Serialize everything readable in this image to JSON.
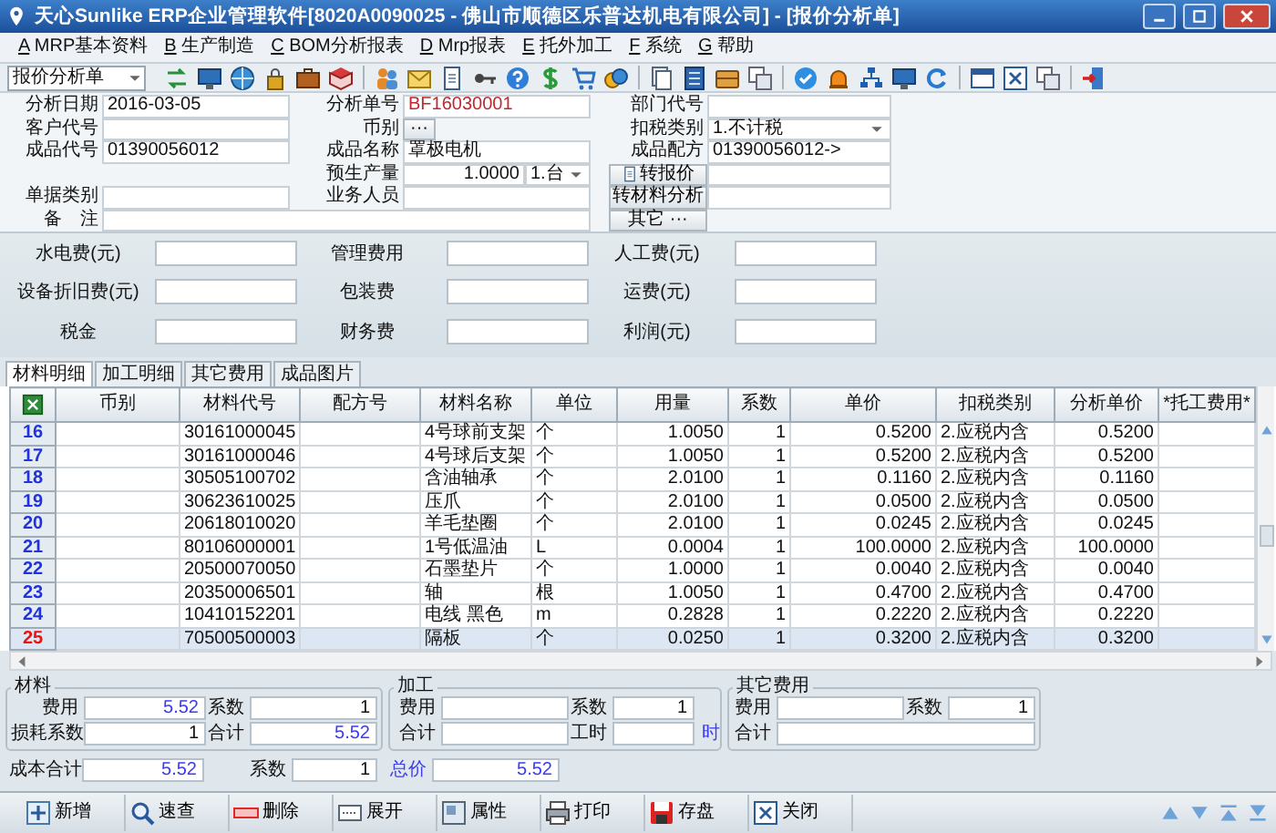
{
  "window": {
    "title": "天心Sunlike ERP企业管理软件[8020A0090025 - 佛山市顺德区乐普达机电有限公司] - [报价分析单]"
  },
  "menu": [
    {
      "key": "A",
      "label": "MRP基本资料"
    },
    {
      "key": "B",
      "label": "生产制造"
    },
    {
      "key": "C",
      "label": "BOM分析报表"
    },
    {
      "key": "D",
      "label": "Mrp报表"
    },
    {
      "key": "E",
      "label": "托外加工"
    },
    {
      "key": "F",
      "label": "系统"
    },
    {
      "key": "G",
      "label": "帮助"
    }
  ],
  "toolbar": {
    "document_type": "报价分析单"
  },
  "header": [
    {
      "left": {
        "kind": "text",
        "label": "分析日期",
        "value": "2016-03-05"
      },
      "middle": {
        "kind": "code",
        "label": "分析单号",
        "value": "BF16030001"
      },
      "right": {
        "kind": "text",
        "label": "部门代号"
      }
    },
    {
      "left": {
        "kind": "text",
        "label": "客户代号"
      },
      "middle": {
        "kind": "picker",
        "label": "币别",
        "button": "···"
      },
      "right": {
        "kind": "select",
        "label": "扣税类别",
        "value": "1.不计税"
      }
    },
    {
      "left": {
        "kind": "text",
        "label": "成品代号",
        "value": "01390056012"
      },
      "middle": {
        "kind": "text",
        "label": "成品名称",
        "value": "罩极电机"
      },
      "right": {
        "kind": "text",
        "label": "成品配方",
        "value": "01390056012->"
      }
    },
    {
      "middle": {
        "kind": "quantity",
        "label": "预生产量",
        "value": "1.0000",
        "unit": "1.台"
      },
      "right": {
        "kind": "action",
        "button": "转报价"
      }
    },
    {
      "left": {
        "kind": "text",
        "label": "单据类别"
      },
      "middle": {
        "kind": "text",
        "label": "业务人员"
      },
      "right": {
        "kind": "action",
        "button": "转材料分析"
      }
    },
    {
      "left": {
        "kind": "memo",
        "label": "备　注"
      },
      "right": {
        "kind": "action",
        "button": "其它 ···"
      }
    }
  ],
  "costs": [
    {
      "label": "水电费(元)"
    },
    {
      "label": "管理费用"
    },
    {
      "label": "人工费(元)"
    },
    {
      "label": "设备折旧费(元)"
    },
    {
      "label": "包装费"
    },
    {
      "label": "运费(元)"
    },
    {
      "label": "税金"
    },
    {
      "label": "财务费"
    },
    {
      "label": "利润(元)"
    }
  ],
  "tabs": [
    {
      "label": "材料明细",
      "selected": true
    },
    {
      "label": "加工明细",
      "selected": false
    },
    {
      "label": "其它费用",
      "selected": false
    },
    {
      "label": "成品图片",
      "selected": false
    }
  ],
  "table": {
    "columns": [
      {
        "label": "币别"
      },
      {
        "label": "材料代号"
      },
      {
        "label": "配方号"
      },
      {
        "label": "材料名称"
      },
      {
        "label": "单位"
      },
      {
        "label": "用量"
      },
      {
        "label": "系数"
      },
      {
        "label": "单价"
      },
      {
        "label": "扣税类别"
      },
      {
        "label": "分析单价"
      },
      {
        "label": "*托工费用*"
      }
    ],
    "rows": [
      {
        "no": "16",
        "code": "30161000045",
        "name": "4号球前支架",
        "unit": "个",
        "qty": "1.0050",
        "factor": "1",
        "price": "0.5200",
        "tax": "2.应税内含",
        "aprice": "0.5200",
        "selected": false
      },
      {
        "no": "17",
        "code": "30161000046",
        "name": "4号球后支架",
        "unit": "个",
        "qty": "1.0050",
        "factor": "1",
        "price": "0.5200",
        "tax": "2.应税内含",
        "aprice": "0.5200",
        "selected": false
      },
      {
        "no": "18",
        "code": "30505100702",
        "name": "含油轴承",
        "unit": "个",
        "qty": "2.0100",
        "factor": "1",
        "price": "0.1160",
        "tax": "2.应税内含",
        "aprice": "0.1160",
        "selected": false
      },
      {
        "no": "19",
        "code": "30623610025",
        "name": "压爪",
        "unit": "个",
        "qty": "2.0100",
        "factor": "1",
        "price": "0.0500",
        "tax": "2.应税内含",
        "aprice": "0.0500",
        "selected": false
      },
      {
        "no": "20",
        "code": "20618010020",
        "name": "羊毛垫圈",
        "unit": "个",
        "qty": "2.0100",
        "factor": "1",
        "price": "0.0245",
        "tax": "2.应税内含",
        "aprice": "0.0245",
        "selected": false
      },
      {
        "no": "21",
        "code": "80106000001",
        "name": "1号低温油",
        "unit": "L",
        "qty": "0.0004",
        "factor": "1",
        "price": "100.0000",
        "tax": "2.应税内含",
        "aprice": "100.0000",
        "selected": false
      },
      {
        "no": "22",
        "code": "20500070050",
        "name": "石墨垫片",
        "unit": "个",
        "qty": "1.0000",
        "factor": "1",
        "price": "0.0040",
        "tax": "2.应税内含",
        "aprice": "0.0040",
        "selected": false
      },
      {
        "no": "23",
        "code": "20350006501",
        "name": "轴",
        "unit": "根",
        "qty": "1.0050",
        "factor": "1",
        "price": "0.4700",
        "tax": "2.应税内含",
        "aprice": "0.4700",
        "selected": false
      },
      {
        "no": "24",
        "code": "10410152201",
        "name": "电线 黑色",
        "unit": "m",
        "qty": "0.2828",
        "factor": "1",
        "price": "0.2220",
        "tax": "2.应税内含",
        "aprice": "0.2220",
        "selected": false
      },
      {
        "no": "25",
        "code": "70500500003",
        "name": "隔板",
        "unit": "个",
        "qty": "0.0250",
        "factor": "1",
        "price": "0.3200",
        "tax": "2.应税内含",
        "aprice": "0.3200",
        "selected": true
      }
    ]
  },
  "summary": {
    "groups": [
      {
        "title": "材料",
        "fields": [
          {
            "label": "费用",
            "value": "5.52",
            "highlight": true
          },
          {
            "label": "系数",
            "value": "1",
            "highlight": false
          },
          {
            "label": "损耗系数",
            "value": "1",
            "highlight": false
          },
          {
            "label": "合计",
            "value": "5.52",
            "highlight": true
          }
        ]
      },
      {
        "title": "加工",
        "fields": [
          {
            "label": "费用"
          },
          {
            "label": "系数",
            "value": "1",
            "highlight": false
          },
          {
            "label": "合计"
          },
          {
            "label": "工时",
            "suffix": "时"
          }
        ]
      },
      {
        "title": "其它费用",
        "fields": [
          {
            "label": "费用",
            "wide": false
          },
          {
            "label": "系数",
            "value": "1",
            "highlight": false,
            "wide": false
          },
          {
            "label": "合计",
            "wide": true
          }
        ]
      }
    ],
    "totals": [
      {
        "label": "成本合计",
        "value": "5.52",
        "highlight": true,
        "label_highlight": false
      },
      {
        "label": "系数",
        "value": "1",
        "highlight": false,
        "label_highlight": false
      },
      {
        "label": "总价",
        "value": "5.52",
        "highlight": true,
        "label_highlight": true
      }
    ]
  },
  "buttons": [
    {
      "label": "新增"
    },
    {
      "label": "速查"
    },
    {
      "label": "删除"
    },
    {
      "label": "展开"
    },
    {
      "label": "属性"
    },
    {
      "label": "打印"
    },
    {
      "label": "存盘"
    },
    {
      "label": "关闭"
    }
  ]
}
